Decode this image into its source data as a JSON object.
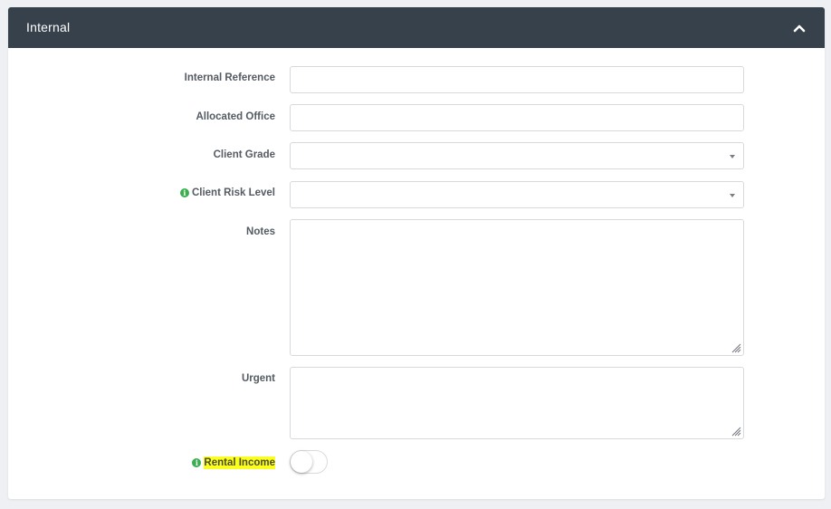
{
  "panel": {
    "title": "Internal",
    "collapse_icon": "chevron-up-icon"
  },
  "form": {
    "internal_reference": {
      "label": "Internal Reference",
      "value": ""
    },
    "allocated_office": {
      "label": "Allocated Office",
      "value": ""
    },
    "client_grade": {
      "label": "Client Grade",
      "value": ""
    },
    "client_risk_level": {
      "label": "Client Risk Level",
      "value": "",
      "info_icon": "info-icon"
    },
    "notes": {
      "label": "Notes",
      "value": ""
    },
    "urgent": {
      "label": "Urgent",
      "value": ""
    },
    "rental_income": {
      "label": "Rental Income",
      "checked": false,
      "info_icon": "info-icon",
      "highlight_color": "#fbff1f"
    }
  },
  "colors": {
    "header_bg": "#37414b",
    "info_green": "#3bae4f",
    "page_bg": "#eef0f3"
  }
}
